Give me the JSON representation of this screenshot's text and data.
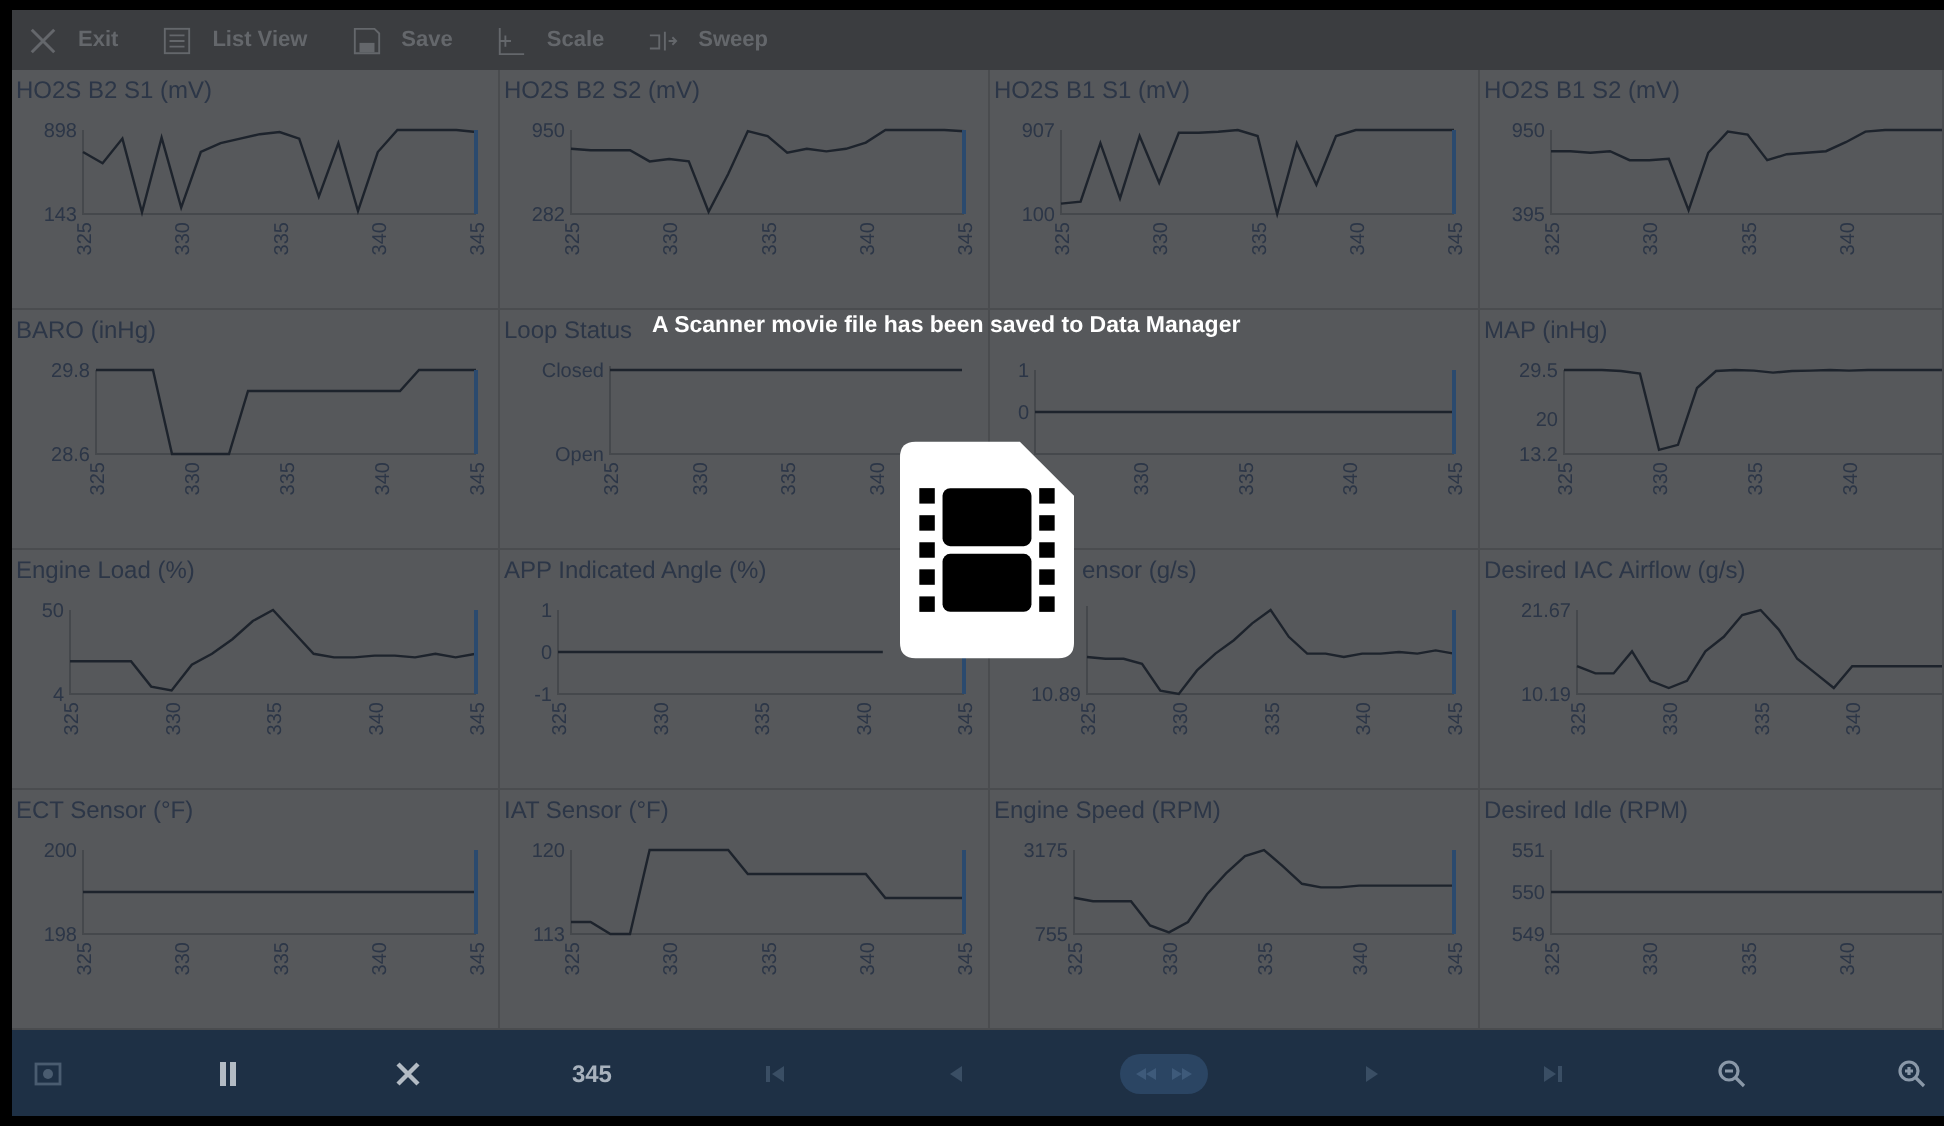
{
  "toolbar": {
    "items": [
      {
        "label": "Exit",
        "kind": "close"
      },
      {
        "label": "List View",
        "kind": "list"
      },
      {
        "label": "Save",
        "kind": "save"
      },
      {
        "label": "Scale",
        "kind": "scale"
      },
      {
        "label": "Sweep",
        "kind": "sweep"
      }
    ]
  },
  "charts": [
    {
      "kind": "chart",
      "chart_data": {
        "type": "line",
        "title": "HO2S B2 S1 (mV)",
        "x": [
          325,
          326,
          327,
          328,
          329,
          330,
          331,
          332,
          333,
          334,
          335,
          336,
          337,
          338,
          339,
          340,
          341,
          342,
          343,
          344,
          345
        ],
        "xlim": [
          325,
          345
        ],
        "ylim": [
          143,
          898
        ],
        "xticks": [
          325,
          330,
          335,
          340,
          345
        ],
        "yticks": [
          143,
          898
        ],
        "series": [
          {
            "color": "#1d232c",
            "values": [
              700,
              600,
              820,
              160,
              830,
              200,
              700,
              780,
              820,
              860,
              880,
              820,
              300,
              780,
              170,
              700,
              898,
              898,
              898,
              898,
              880
            ]
          }
        ]
      }
    },
    {
      "kind": "chart",
      "chart_data": {
        "type": "line",
        "title": "HO2S B2 S2 (mV)",
        "x": [
          325,
          326,
          327,
          328,
          329,
          330,
          331,
          332,
          333,
          334,
          335,
          336,
          337,
          338,
          339,
          340,
          341,
          342,
          343,
          344,
          345
        ],
        "xlim": [
          325,
          345
        ],
        "ylim": [
          282,
          950
        ],
        "xticks": [
          325,
          330,
          335,
          340,
          345
        ],
        "yticks": [
          282,
          950
        ],
        "series": [
          {
            "color": "#1d232c",
            "values": [
              800,
              790,
              790,
              790,
              700,
              720,
              700,
              300,
              600,
              940,
              900,
              770,
              800,
              780,
              800,
              850,
              950,
              950,
              950,
              950,
              940
            ]
          }
        ]
      }
    },
    {
      "kind": "chart",
      "chart_data": {
        "type": "line",
        "title": "HO2S B1 S1 (mV)",
        "x": [
          325,
          326,
          327,
          328,
          329,
          330,
          331,
          332,
          333,
          334,
          335,
          336,
          337,
          338,
          339,
          340,
          341,
          342,
          343,
          344,
          345
        ],
        "xlim": [
          325,
          345
        ],
        "ylim": [
          100,
          907
        ],
        "xticks": [
          325,
          330,
          335,
          340,
          345
        ],
        "yticks": [
          100,
          907
        ],
        "series": [
          {
            "color": "#1d232c",
            "values": [
              200,
              220,
              780,
              250,
              850,
              400,
              880,
              880,
              890,
              907,
              850,
              100,
              780,
              380,
              850,
              907,
              907,
              907,
              907,
              907,
              907
            ]
          }
        ]
      }
    },
    {
      "kind": "chart",
      "chart_data": {
        "type": "line",
        "title": "HO2S B1 S2 (mV)",
        "x": [
          325,
          326,
          327,
          328,
          329,
          330,
          331,
          332,
          333,
          334,
          335,
          336,
          337,
          338,
          339,
          340,
          341,
          342,
          343,
          344,
          345
        ],
        "xlim": [
          325,
          345
        ],
        "ylim": [
          395,
          950
        ],
        "xticks": [
          325,
          330,
          335,
          340
        ],
        "yticks": [
          395,
          950
        ],
        "series": [
          {
            "color": "#1d232c",
            "values": [
              810,
              810,
              800,
              810,
              750,
              750,
              760,
              420,
              800,
              940,
              920,
              750,
              790,
              800,
              810,
              870,
              940,
              950,
              950,
              950,
              950
            ]
          }
        ]
      }
    },
    {
      "kind": "chart",
      "chart_data": {
        "type": "line",
        "title": "BARO (inHg)",
        "x": [
          325,
          326,
          327,
          328,
          329,
          330,
          331,
          332,
          333,
          334,
          335,
          336,
          337,
          338,
          339,
          340,
          341,
          342,
          343,
          344,
          345
        ],
        "xlim": [
          325,
          345
        ],
        "ylim": [
          28.6,
          29.8
        ],
        "xticks": [
          325,
          330,
          335,
          340,
          345
        ],
        "yticks": [
          28.6,
          29.8
        ],
        "series": [
          {
            "color": "#1d232c",
            "values": [
              29.8,
              29.8,
              29.8,
              29.8,
              28.6,
              28.6,
              28.6,
              28.6,
              29.5,
              29.5,
              29.5,
              29.5,
              29.5,
              29.5,
              29.5,
              29.5,
              29.5,
              29.8,
              29.8,
              29.8,
              29.8
            ]
          }
        ]
      }
    },
    {
      "kind": "status",
      "title": "Loop Status",
      "axis_labels": [
        "Closed",
        "Open"
      ],
      "x_labels": [
        "325",
        "330",
        "335",
        "340"
      ]
    },
    {
      "kind": "chart",
      "chart_data": {
        "type": "line",
        "x": [
          325,
          326,
          327,
          328,
          329,
          330,
          331,
          332,
          333,
          334,
          335,
          336,
          337,
          338,
          339,
          340,
          341,
          342,
          343,
          344,
          345
        ],
        "xlim": [
          325,
          345
        ],
        "ylim": [
          -1,
          1
        ],
        "xticks": [
          330,
          335,
          340,
          345
        ],
        "yticks": [
          0,
          1
        ],
        "series": [
          {
            "color": "#1d232c",
            "values": [
              0,
              0,
              0,
              0,
              0,
              0,
              0,
              0,
              0,
              0,
              0,
              0,
              0,
              0,
              0,
              0,
              0,
              0,
              0,
              0,
              0
            ]
          }
        ]
      }
    },
    {
      "kind": "chart",
      "chart_data": {
        "type": "line",
        "title": "MAP (inHg)",
        "x": [
          325,
          326,
          327,
          328,
          329,
          330,
          331,
          332,
          333,
          334,
          335,
          336,
          337,
          338,
          339,
          340,
          341,
          342,
          343,
          344,
          345
        ],
        "xlim": [
          325,
          345
        ],
        "ylim": [
          13.2,
          29.5
        ],
        "xticks": [
          325,
          330,
          335,
          340
        ],
        "yticks": [
          13.2,
          20.0,
          29.5
        ],
        "series": [
          {
            "color": "#1d232c",
            "values": [
              29.5,
              29.5,
              29.5,
              29.3,
              28.8,
              14,
              15,
              26,
              29.3,
              29.5,
              29.4,
              29,
              29.3,
              29.4,
              29.5,
              29.4,
              29.5,
              29.5,
              29.5,
              29.5,
              29.5
            ]
          }
        ]
      }
    },
    {
      "kind": "chart",
      "chart_data": {
        "type": "line",
        "title": "Engine Load (%)",
        "x": [
          325,
          326,
          327,
          328,
          329,
          330,
          331,
          332,
          333,
          334,
          335,
          336,
          337,
          338,
          339,
          340,
          341,
          342,
          343,
          344,
          345
        ],
        "xlim": [
          325,
          345
        ],
        "ylim": [
          4,
          50
        ],
        "xticks": [
          325,
          330,
          335,
          340,
          345
        ],
        "yticks": [
          4,
          50
        ],
        "series": [
          {
            "color": "#1d232c",
            "values": [
              22,
              22,
              22,
              22,
              8,
              6,
              20,
              26,
              34,
              44,
              50,
              38,
              26,
              24,
              24,
              25,
              25,
              24,
              26,
              24,
              26
            ]
          }
        ]
      }
    },
    {
      "kind": "chart",
      "chart_data": {
        "type": "line",
        "title": "APP Indicated Angle (%)",
        "x": [
          325,
          326,
          327,
          328,
          329,
          330,
          331,
          332,
          333,
          334,
          335,
          336,
          337,
          338,
          339,
          340,
          341
        ],
        "xlim": [
          325,
          345
        ],
        "ylim": [
          -1,
          1
        ],
        "xticks": [
          325,
          330,
          335,
          340,
          345
        ],
        "yticks": [
          -1,
          0,
          1
        ],
        "series": [
          {
            "color": "#1d232c",
            "values": [
              0,
              0,
              0,
              0,
              0,
              0,
              0,
              0,
              0,
              0,
              0,
              0,
              0,
              0,
              0,
              0,
              0
            ]
          }
        ]
      }
    },
    {
      "kind": "trace",
      "title": "ensor (g/s)",
      "axis_labels": [
        "10.89"
      ],
      "x_labels": [
        "325",
        "330",
        "335",
        "340",
        "345"
      ]
    },
    {
      "kind": "chart",
      "chart_data": {
        "type": "line",
        "title": "Desired IAC Airflow (g/s)",
        "x": [
          325,
          326,
          327,
          328,
          329,
          330,
          331,
          332,
          333,
          334,
          335,
          336,
          337,
          338,
          339,
          340,
          341,
          342,
          343,
          344,
          345
        ],
        "xlim": [
          325,
          345
        ],
        "ylim": [
          10.19,
          21.67
        ],
        "xticks": [
          325,
          330,
          335,
          340
        ],
        "yticks": [
          10.19,
          21.67
        ],
        "series": [
          {
            "color": "#1d232c",
            "values": [
              14,
              13,
              13,
              16,
              12,
              11,
              12,
              16,
              18,
              21,
              21.67,
              19,
              15,
              13,
              11,
              14,
              14,
              14,
              14,
              14,
              14
            ]
          }
        ]
      }
    },
    {
      "kind": "chart",
      "chart_data": {
        "type": "line",
        "title": "ECT Sensor (°F)",
        "x": [
          325,
          326,
          327,
          328,
          329,
          330,
          331,
          332,
          333,
          334,
          335,
          336,
          337,
          338,
          339,
          340,
          341,
          342,
          343,
          344,
          345
        ],
        "xlim": [
          325,
          345
        ],
        "ylim": [
          198,
          200
        ],
        "xticks": [
          325,
          330,
          335,
          340,
          345
        ],
        "yticks": [
          198,
          200
        ],
        "series": [
          {
            "color": "#1d232c",
            "values": [
              199,
              199,
              199,
              199,
              199,
              199,
              199,
              199,
              199,
              199,
              199,
              199,
              199,
              199,
              199,
              199,
              199,
              199,
              199,
              199,
              199
            ]
          }
        ]
      }
    },
    {
      "kind": "chart",
      "chart_data": {
        "type": "line",
        "title": "IAT Sensor (°F)",
        "x": [
          325,
          326,
          327,
          328,
          329,
          330,
          331,
          332,
          333,
          334,
          335,
          336,
          337,
          338,
          339,
          340,
          341,
          342,
          343,
          344,
          345
        ],
        "xlim": [
          325,
          345
        ],
        "ylim": [
          113,
          120
        ],
        "xticks": [
          325,
          330,
          335,
          340,
          345
        ],
        "yticks": [
          113,
          120
        ],
        "series": [
          {
            "color": "#1d232c",
            "values": [
              114,
              114,
              113,
              113,
              120,
              120,
              120,
              120,
              120,
              118,
              118,
              118,
              118,
              118,
              118,
              118,
              116,
              116,
              116,
              116,
              116
            ]
          }
        ]
      }
    },
    {
      "kind": "chart",
      "chart_data": {
        "type": "line",
        "title": "Engine Speed (RPM)",
        "x": [
          325,
          326,
          327,
          328,
          329,
          330,
          331,
          332,
          333,
          334,
          335,
          336,
          337,
          338,
          339,
          340,
          341,
          342,
          343,
          344,
          345
        ],
        "xlim": [
          325,
          345
        ],
        "ylim": [
          755,
          3175
        ],
        "xticks": [
          325,
          330,
          335,
          340,
          345
        ],
        "yticks": [
          755,
          3175
        ],
        "series": [
          {
            "color": "#1d232c",
            "values": [
              1800,
              1700,
              1700,
              1700,
              1000,
              800,
              1100,
              1900,
              2500,
              3000,
              3175,
              2700,
              2200,
              2100,
              2100,
              2150,
              2150,
              2150,
              2150,
              2150,
              2150
            ]
          }
        ]
      }
    },
    {
      "kind": "chart",
      "chart_data": {
        "type": "line",
        "title": "Desired Idle (RPM)",
        "x": [
          325,
          326,
          327,
          328,
          329,
          330,
          331,
          332,
          333,
          334,
          335,
          336,
          337,
          338,
          339,
          340,
          341,
          342,
          343,
          344,
          345
        ],
        "xlim": [
          325,
          345
        ],
        "ylim": [
          549,
          551
        ],
        "xticks": [
          325,
          330,
          335,
          340
        ],
        "yticks": [
          549,
          550,
          551
        ],
        "series": [
          {
            "color": "#1d232c",
            "values": [
              550,
              550,
              550,
              550,
              550,
              550,
              550,
              550,
              550,
              550,
              550,
              550,
              550,
              550,
              550,
              550,
              550,
              550,
              550,
              550,
              550
            ]
          }
        ]
      }
    }
  ],
  "toast": {
    "message": "A Scanner movie file has been saved to Data Manager"
  },
  "bottom_bar": {
    "frame": "345"
  }
}
